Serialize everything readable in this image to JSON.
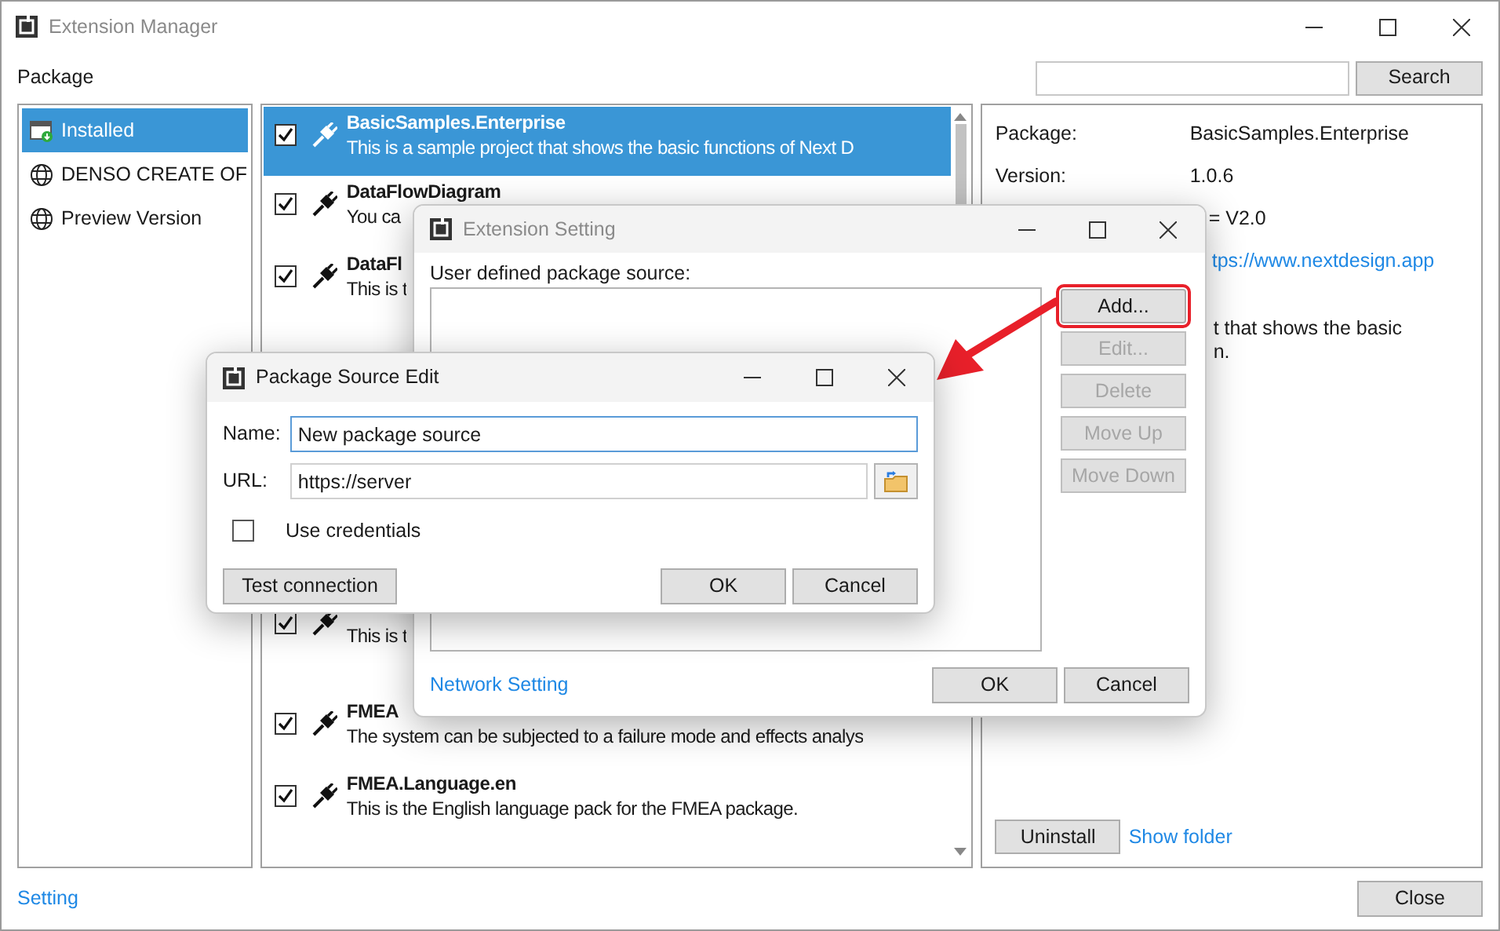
{
  "main_window": {
    "title": "Extension Manager",
    "package_label": "Package",
    "search_button": "Search"
  },
  "sources": [
    {
      "label": "Installed",
      "kind": "installed",
      "selected": true
    },
    {
      "label": "DENSO CREATE OF",
      "kind": "globe",
      "selected": false
    },
    {
      "label": "Preview Version",
      "kind": "globe",
      "selected": false
    }
  ],
  "packages": [
    {
      "title": "BasicSamples.Enterprise",
      "description": "This is a sample project that shows the basic functions of Next D",
      "checked": true,
      "selected": true
    },
    {
      "title": "DataFlowDiagram",
      "description": "You ca",
      "checked": true,
      "selected": false
    },
    {
      "title": "DataFl",
      "description": "This is t",
      "checked": true,
      "selected": false
    },
    {
      "description": "This is t",
      "checked": true,
      "selected": false
    },
    {
      "title": "FMEA",
      "description": "The system can be subjected to a failure mode and effects analys",
      "checked": true,
      "selected": false
    },
    {
      "title": "FMEA.Language.en",
      "description": "This is the English language pack for the FMEA package.",
      "checked": true,
      "selected": false
    }
  ],
  "details": {
    "rows": [
      {
        "label": "Package:",
        "value": "BasicSamples.Enterprise"
      },
      {
        "label": "Version:",
        "value": "1.0.6"
      },
      {
        "value": "= V2.0"
      },
      {
        "link": "tps://www.nextdesign.app"
      }
    ],
    "description": [
      "t that shows the basic",
      "n."
    ],
    "uninstall_button": "Uninstall",
    "show_folder_link": "Show folder"
  },
  "footer": {
    "setting_link": "Setting",
    "close_button": "Close"
  },
  "extension_setting": {
    "title": "Extension Setting",
    "source_label": "User defined package source:",
    "buttons": [
      {
        "label": "Add...",
        "disabled": false,
        "highlighted": true
      },
      {
        "label": "Edit...",
        "disabled": true,
        "highlighted": false
      },
      {
        "label": "Delete",
        "disabled": true,
        "highlighted": false
      },
      {
        "label": "Move Up",
        "disabled": true,
        "highlighted": false
      },
      {
        "label": "Move Down",
        "disabled": true,
        "highlighted": false
      }
    ],
    "network_link": "Network Setting",
    "ok": "OK",
    "cancel": "Cancel"
  },
  "package_source_edit": {
    "title": "Package Source Edit",
    "name_label": "Name:",
    "name_value": "New package source",
    "url_label": "URL:",
    "url_value": "https://server",
    "use_credentials": {
      "label": "Use credentials",
      "checked": false
    },
    "test_button": "Test connection",
    "ok": "OK",
    "cancel": "Cancel"
  }
}
